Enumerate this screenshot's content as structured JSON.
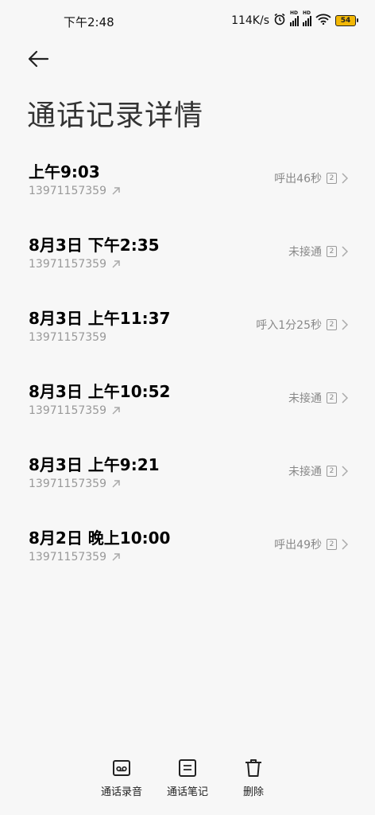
{
  "status_bar": {
    "time": "下午2:48",
    "net_speed": "114K/s",
    "signal_hd": "HD",
    "battery": "54",
    "battery_color": "#f2b705"
  },
  "header": {
    "back_icon": "arrow-left-icon",
    "title": "通话记录详情"
  },
  "calls": [
    {
      "datetime": "上午9:03",
      "number": "13971157359",
      "status": "呼出46秒",
      "sim": "2"
    },
    {
      "datetime": "8月3日 下午2:35",
      "number": "13971157359",
      "status": "未接通",
      "sim": "2"
    },
    {
      "datetime": "8月3日 上午11:37",
      "number": "13971157359",
      "status": "呼入1分25秒",
      "sim": "2"
    },
    {
      "datetime": "8月3日 上午10:52",
      "number": "13971157359",
      "status": "未接通",
      "sim": "2"
    },
    {
      "datetime": "8月3日 上午9:21",
      "number": "13971157359",
      "status": "未接通",
      "sim": "2"
    },
    {
      "datetime": "8月2日 晚上10:00",
      "number": "13971157359",
      "status": "呼出49秒",
      "sim": "2"
    }
  ],
  "bottom_bar": {
    "recording": {
      "label": "通话录音",
      "icon": "voicemail-icon"
    },
    "notes": {
      "label": "通话笔记",
      "icon": "note-icon"
    },
    "delete": {
      "label": "删除",
      "icon": "trash-icon"
    }
  }
}
